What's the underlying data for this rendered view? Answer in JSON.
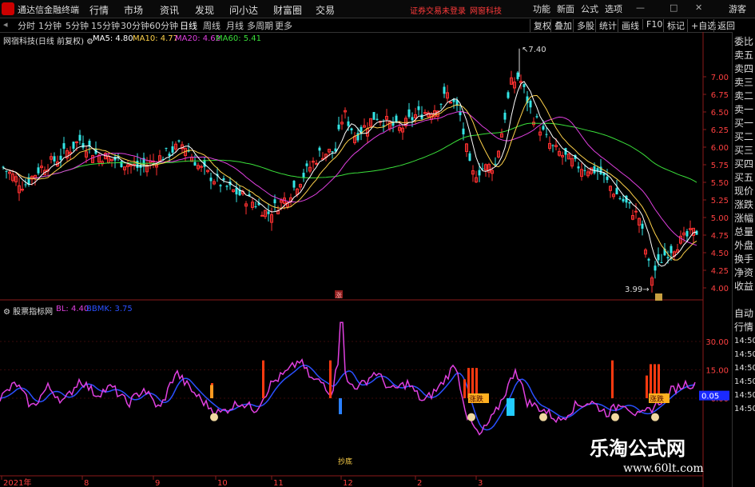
{
  "app": {
    "title": "通达信金融终端"
  },
  "menu": [
    "行情",
    "市场",
    "资讯",
    "发现",
    "问小达",
    "财富圈",
    "交易"
  ],
  "notice": {
    "left": "证券交易未登录",
    "right": "网窗科技"
  },
  "window": [
    "功能",
    "新面",
    "公式",
    "选项"
  ],
  "guest": "游客",
  "periods": [
    "分时",
    "1分钟",
    "5分钟",
    "15分钟",
    "30分钟",
    "60分钟",
    "日线",
    "周线",
    "月线",
    "多周期",
    "更多"
  ],
  "right_tools": [
    "复权",
    "叠加",
    "多股",
    "统计",
    "画线",
    "F10",
    "标记",
    "+自选",
    "返回"
  ],
  "stock": {
    "name": "网宿科技",
    "mode": "(日线 前复权)"
  },
  "ma": [
    {
      "label": "MA5:",
      "value": "4.80",
      "color": "#ffffff"
    },
    {
      "label": "MA10:",
      "value": "4.77",
      "color": "#ffd24a"
    },
    {
      "label": "MA20:",
      "value": "4.62",
      "color": "#e040e0"
    },
    {
      "label": "MA60:",
      "value": "5.41",
      "color": "#3adf3a"
    }
  ],
  "price_axis": [
    "7.00",
    "6.75",
    "6.50",
    "6.25",
    "6.00",
    "5.75",
    "5.50",
    "5.25",
    "5.00",
    "4.75",
    "4.50",
    "4.25",
    "4.00"
  ],
  "high_label": "7.40",
  "low_label": "3.99",
  "marker_zhang": "涨",
  "indicator": {
    "name": "股票指标网",
    "bl_label": "BL:",
    "bl_value": "4.40",
    "bbmk_label": "BBMK:",
    "bbmk_value": "3.75"
  },
  "ind_axis": [
    "30.00",
    "15.00",
    "0.00"
  ],
  "ind_value": "0.05",
  "ind_tags": [
    "涨跌",
    "涨跌",
    "抄底"
  ],
  "side_quote": [
    "委比",
    "卖五",
    "卖四",
    "卖三",
    "卖二",
    "卖一",
    "买一",
    "买二",
    "买三",
    "买四",
    "买五",
    "现价",
    "涨跌",
    "涨幅",
    "总量",
    "外盘",
    "换手",
    "净资",
    "收益"
  ],
  "side_times": [
    "自动",
    "行情",
    "14:50",
    "14:50",
    "14:50",
    "14:50",
    "14:50",
    "14:50"
  ],
  "date_axis": [
    "2021年",
    "8",
    "9",
    "10",
    "11",
    "12",
    "2",
    "3"
  ],
  "watermark": {
    "title": "乐淘公式网",
    "url": "www.60lt.com"
  },
  "colors": {
    "up": "#ff3030",
    "down": "#33e6e6",
    "ma5": "#ffffff",
    "ma10": "#ffd24a",
    "ma20": "#e040e0",
    "ma60": "#3adf3a",
    "bl": "#e040e0",
    "bbmk": "#2a50ff"
  }
}
